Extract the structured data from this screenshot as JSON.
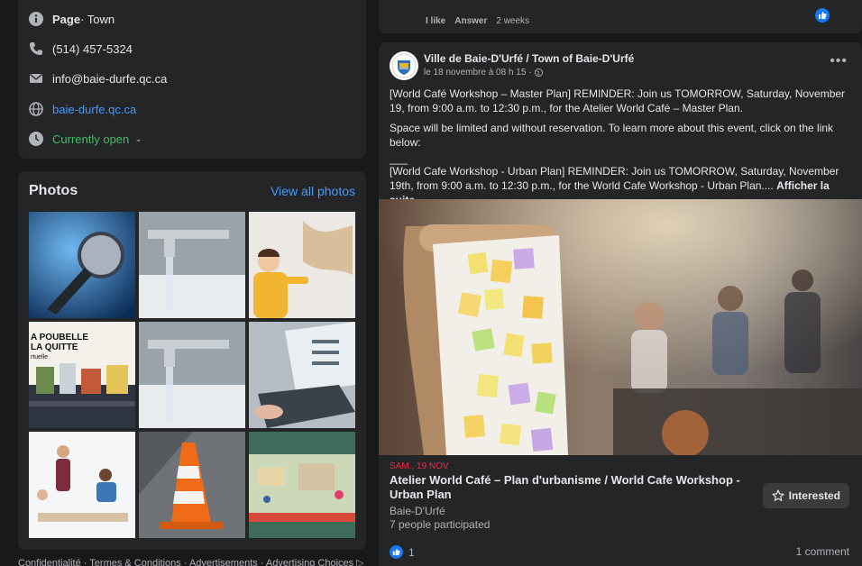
{
  "intro": {
    "category_bold": "Page",
    "category_rest": " · Town",
    "phone": "(514) 457-5324",
    "email": "info@baie-durfe.qc.ca",
    "website": "baie-durfe.qc.ca",
    "hours": "Currently open"
  },
  "photos": {
    "title": "Photos",
    "view_all": "View all photos",
    "thumb_text_1": "A POUBELLE",
    "thumb_text_2": "LA QUITTE",
    "thumb_text_3": "rtuelle"
  },
  "footer": {
    "links": "Confidentialité · Termes & Conditions · Advertisements · Advertising Choices ▷"
  },
  "prev_comment": {
    "like": "I like",
    "answer": "Answer",
    "time": "2 weeks"
  },
  "post": {
    "author": "Ville de Baie-D'Urfé / Town of Baie-D'Urfé",
    "time": "le 18 novembre à 08 h 15 ·",
    "more": "•••",
    "para1": "[World Café Workshop – Master Plan] REMINDER: Join us TOMORROW, Saturday, November 19, from 9:00 a.m. to 12:30 p.m., for the Atelier World Café – Master Plan.",
    "para2": "Space will be limited and without reservation. To learn more about this event, click on the link below:",
    "divider": "___",
    "para3": "[World Cafe Workshop - Urban Plan] REMINDER: Join us TOMORROW, Saturday, November 19th, from 9:00 a.m. to 12:30 p.m., for the World Cafe Workshop - Urban Plan....",
    "see_more": "Afficher la suite"
  },
  "event": {
    "date": "SAM., 19 NOV",
    "title": "Atelier World Café – Plan d'urbanisme / World Cafe Workshop - Urban Plan",
    "place": "Baie-D'Urfé",
    "participants": "7 people participated",
    "interested": "Interested"
  },
  "footer_post": {
    "likes": "1",
    "comments": "1 comment"
  },
  "colors": {
    "background": "#18191a",
    "card": "#242526",
    "link": "#4599ff",
    "open": "#45bd62",
    "like": "#1877f2",
    "event_date": "#f02849"
  }
}
